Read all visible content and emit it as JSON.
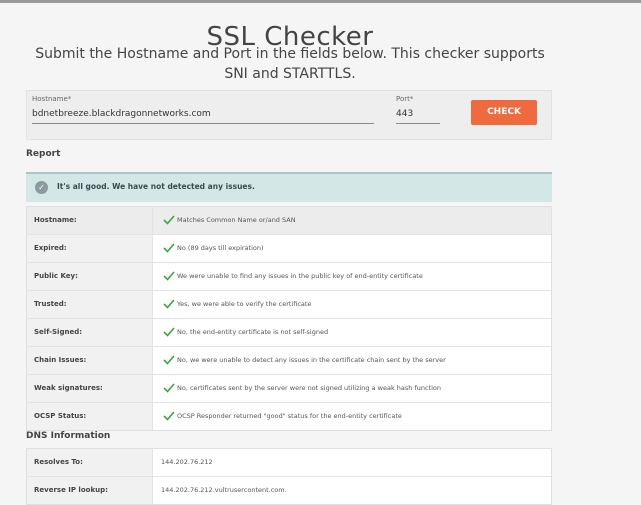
{
  "page": {
    "title": "SSL Checker",
    "subtitle": "Submit the Hostname and Port in the fields below. This checker supports SNI and STARTTLS."
  },
  "form": {
    "hostname_label": "Hostname*",
    "hostname_value": "bdnetbreeze.blackdragonnetworks.com",
    "port_label": "Port*",
    "port_value": "443",
    "check_label": "CHECK"
  },
  "report": {
    "heading": "Report",
    "banner": "It's all good. We have not detected any issues.",
    "banner_icon": "check-circle-icon",
    "rows": [
      {
        "label": "Hostname:",
        "value": "Matches Common Name or/and SAN"
      },
      {
        "label": "Expired:",
        "value": "No (89 days till expiration)"
      },
      {
        "label": "Public Key:",
        "value": "We were unable to find any issues in the public key of end-entity certificate"
      },
      {
        "label": "Trusted:",
        "value": "Yes, we were able to verify the certificate"
      },
      {
        "label": "Self-Signed:",
        "value": "No, the end-entity certificate is not self-signed"
      },
      {
        "label": "Chain Issues:",
        "value": "No, we were unable to detect any issues in the certificate chain sent by the server"
      },
      {
        "label": "Weak signatures:",
        "value": "No, certificates sent by the server were not signed utilizing a weak hash function"
      },
      {
        "label": "OCSP Status:",
        "value": "OCSP Responder returned \"good\" status for the end-entity certificate"
      }
    ]
  },
  "dns": {
    "heading": "DNS Information",
    "rows": [
      {
        "label": "Resolves To:",
        "value": "144.202.76.212"
      },
      {
        "label": "Reverse IP lookup:",
        "value": "144.202.76.212.vultrusercontent.com."
      }
    ]
  },
  "colors": {
    "accent": "#ef6a3f",
    "check_green": "#3aa63a",
    "banner_bg": "#d3e7e7"
  }
}
